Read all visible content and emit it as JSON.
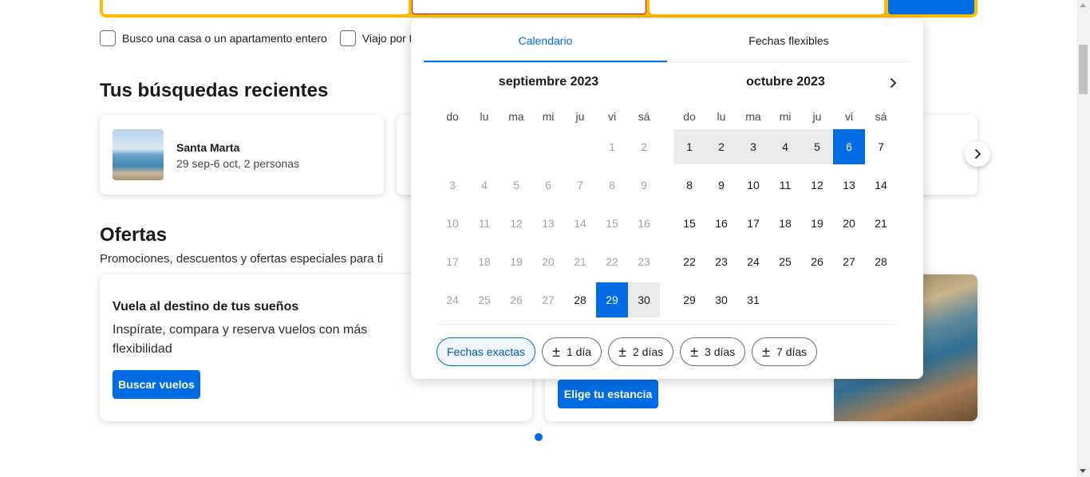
{
  "search": {
    "options": [
      "Busco una casa o un apartamento entero",
      "Viajo por t"
    ]
  },
  "recent": {
    "title": "Tus búsquedas recientes",
    "items": [
      {
        "name": "Santa Marta",
        "detail": "29 sep-6 oct, 2 personas"
      }
    ]
  },
  "offers": {
    "title": "Ofertas",
    "subtitle": "Promociones, descuentos y ofertas especiales para ti",
    "cards": [
      {
        "title": "Vuela al destino de tus sueños",
        "description": "Inspírate, compara y reserva vuelos con más flexibilidad",
        "button": "Buscar vuelos"
      },
      {
        "button": "Elige tu estancia"
      }
    ]
  },
  "datepicker": {
    "tabs": [
      "Calendario",
      "Fechas flexibles"
    ],
    "active_tab": "Calendario",
    "weekdays": [
      "do",
      "lu",
      "ma",
      "mi",
      "ju",
      "vi",
      "sá"
    ],
    "months": [
      {
        "title": "septiembre 2023",
        "leading_blanks": 5,
        "days": 30,
        "past_until": 27,
        "selected": [
          29
        ],
        "in_range": [
          30
        ]
      },
      {
        "title": "octubre 2023",
        "leading_blanks": 0,
        "days": 31,
        "past_until": 0,
        "selected": [
          6
        ],
        "in_range": [
          1,
          2,
          3,
          4,
          5
        ]
      }
    ],
    "flex_chips": [
      {
        "label": "Fechas exactas",
        "plus_minus": false,
        "active": true
      },
      {
        "label": "1 día",
        "plus_minus": true,
        "active": false
      },
      {
        "label": "2 días",
        "plus_minus": true,
        "active": false
      },
      {
        "label": "3 días",
        "plus_minus": true,
        "active": false
      },
      {
        "label": "7 días",
        "plus_minus": true,
        "active": false
      }
    ]
  },
  "colors": {
    "accent": "#006ce4",
    "search_border": "#febb02",
    "range": "#ebebeb"
  }
}
